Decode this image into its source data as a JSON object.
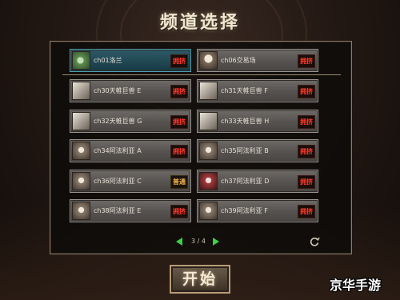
{
  "title": "频道选择",
  "channels": [
    {
      "name": "ch01洛兰",
      "status": "拥挤",
      "icon": "plant-monster-icon"
    },
    {
      "name": "ch06交易场",
      "status": "拥挤",
      "icon": "merchant-icon"
    },
    {
      "name": "ch30天帷巨兽 E",
      "status": "拥挤",
      "icon": "beast-icon"
    },
    {
      "name": "ch31天帷巨兽 F",
      "status": "拥挤",
      "icon": "beast-icon"
    },
    {
      "name": "ch32天帷巨兽 G",
      "status": "拥挤",
      "icon": "beast-icon"
    },
    {
      "name": "ch33天帷巨兽 H",
      "status": "拥挤",
      "icon": "beast-icon"
    },
    {
      "name": "ch34阿法利亚 A",
      "status": "拥挤",
      "icon": "demon-icon"
    },
    {
      "name": "ch35阿法利亚 B",
      "status": "拥挤",
      "icon": "demon-icon"
    },
    {
      "name": "ch36阿法利亚 C",
      "status": "普通",
      "icon": "demon-icon"
    },
    {
      "name": "ch37阿法利亚 D",
      "status": "拥挤",
      "icon": "demon-red-icon"
    },
    {
      "name": "ch38阿法利亚 E",
      "status": "拥挤",
      "icon": "demon-icon"
    },
    {
      "name": "ch39阿法利亚 F",
      "status": "拥挤",
      "icon": "demon-icon"
    }
  ],
  "pager": {
    "text": "3 / 4"
  },
  "start_label": "开始",
  "watermark": "京华手游",
  "colors": {
    "crowded": "#ff3a2a",
    "normal": "#f0b24a",
    "selected": "#1f4752",
    "pager_arrow": "#3fd04a"
  }
}
